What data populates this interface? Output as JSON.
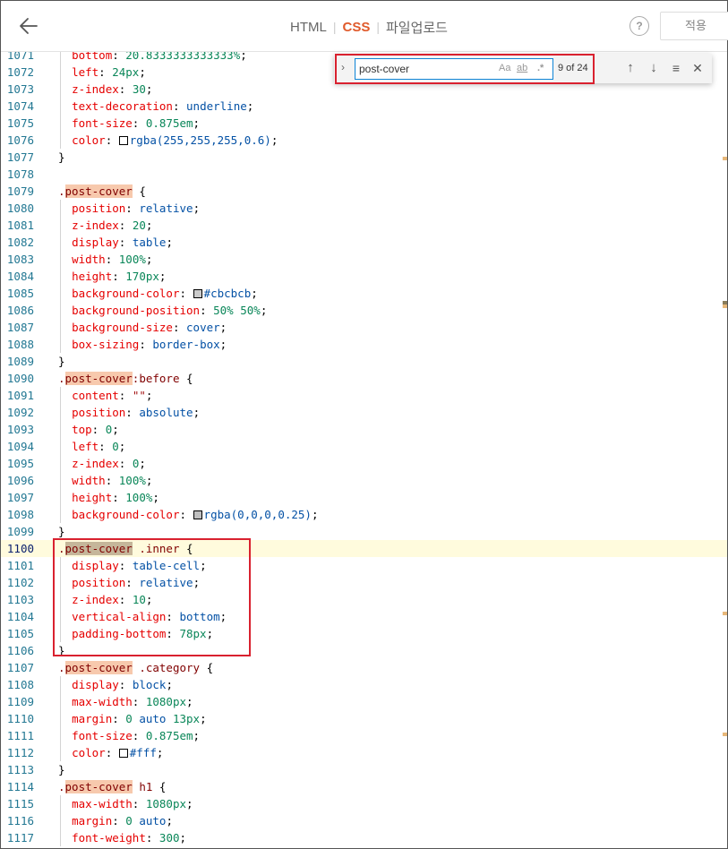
{
  "header": {
    "tabs": [
      {
        "label": "HTML",
        "active": false
      },
      {
        "label": "CSS",
        "active": true
      },
      {
        "label": "파일업로드",
        "active": false
      }
    ],
    "help_label": "?",
    "apply_label": "적용"
  },
  "find": {
    "query": "post-cover",
    "match_case": "Aa",
    "whole_word": "ab",
    "regex": ".*",
    "count": "9 of 24"
  },
  "colors": {
    "accent": "#e05a2b",
    "highlight_box": "#d9212f",
    "match_bg": "#f7c9ad",
    "current_line": "#fffbdd"
  },
  "editor": {
    "current_line": 1100,
    "lines": [
      {
        "n": 1071,
        "html": "  <span class='tk-prop'>bottom</span>: <span class='tk-num'>20.8333333333333%</span>;"
      },
      {
        "n": 1072,
        "html": "  <span class='tk-prop'>left</span>: <span class='tk-num'>24px</span>;"
      },
      {
        "n": 1073,
        "html": "  <span class='tk-prop'>z-index</span>: <span class='tk-num'>30</span>;"
      },
      {
        "n": 1074,
        "html": "  <span class='tk-prop'>text-decoration</span>: <span class='tk-val'>underline</span>;"
      },
      {
        "n": 1075,
        "html": "  <span class='tk-prop'>font-size</span>: <span class='tk-num'>0.875em</span>;"
      },
      {
        "n": 1076,
        "html": "  <span class='tk-prop'>color</span>: <span class='swatch' style='background:rgba(255,255,255,0.6)'></span><span class='tk-val'>rgba(255,255,255,0.6)</span>;"
      },
      {
        "n": 1077,
        "html": "}"
      },
      {
        "n": 1078,
        "html": ""
      },
      {
        "n": 1079,
        "html": "<span class='tk-sel'>.<span class='match'>post-cover</span></span> {"
      },
      {
        "n": 1080,
        "html": "  <span class='tk-prop'>position</span>: <span class='tk-val'>relative</span>;"
      },
      {
        "n": 1081,
        "html": "  <span class='tk-prop'>z-index</span>: <span class='tk-num'>20</span>;"
      },
      {
        "n": 1082,
        "html": "  <span class='tk-prop'>display</span>: <span class='tk-val'>table</span>;"
      },
      {
        "n": 1083,
        "html": "  <span class='tk-prop'>width</span>: <span class='tk-num'>100%</span>;"
      },
      {
        "n": 1084,
        "html": "  <span class='tk-prop'>height</span>: <span class='tk-num'>170px</span>;"
      },
      {
        "n": 1085,
        "html": "  <span class='tk-prop'>background-color</span>: <span class='swatch' style='background:#cbcbcb'></span><span class='tk-val'>#cbcbcb</span>;"
      },
      {
        "n": 1086,
        "html": "  <span class='tk-prop'>background-position</span>: <span class='tk-num'>50% 50%</span>;"
      },
      {
        "n": 1087,
        "html": "  <span class='tk-prop'>background-size</span>: <span class='tk-val'>cover</span>;"
      },
      {
        "n": 1088,
        "html": "  <span class='tk-prop'>box-sizing</span>: <span class='tk-val'>border-box</span>;"
      },
      {
        "n": 1089,
        "html": "}"
      },
      {
        "n": 1090,
        "html": "<span class='tk-sel'>.<span class='match'>post-cover</span>:before</span> {"
      },
      {
        "n": 1091,
        "html": "  <span class='tk-prop'>content</span>: <span class='tk-str'>\"\"</span>;"
      },
      {
        "n": 1092,
        "html": "  <span class='tk-prop'>position</span>: <span class='tk-val'>absolute</span>;"
      },
      {
        "n": 1093,
        "html": "  <span class='tk-prop'>top</span>: <span class='tk-num'>0</span>;"
      },
      {
        "n": 1094,
        "html": "  <span class='tk-prop'>left</span>: <span class='tk-num'>0</span>;"
      },
      {
        "n": 1095,
        "html": "  <span class='tk-prop'>z-index</span>: <span class='tk-num'>0</span>;"
      },
      {
        "n": 1096,
        "html": "  <span class='tk-prop'>width</span>: <span class='tk-num'>100%</span>;"
      },
      {
        "n": 1097,
        "html": "  <span class='tk-prop'>height</span>: <span class='tk-num'>100%</span>;"
      },
      {
        "n": 1098,
        "html": "  <span class='tk-prop'>background-color</span>: <span class='swatch' style='background:rgba(0,0,0,0.25)'></span><span class='tk-val'>rgba(0,0,0,0.25)</span>;"
      },
      {
        "n": 1099,
        "html": "}"
      },
      {
        "n": 1100,
        "html": "<span class='tk-sel'>.<span class='match curmatch'>post-cover</span> .inner</span> {"
      },
      {
        "n": 1101,
        "html": "  <span class='tk-prop'>display</span>: <span class='tk-val'>table-cell</span>;"
      },
      {
        "n": 1102,
        "html": "  <span class='tk-prop'>position</span>: <span class='tk-val'>relative</span>;"
      },
      {
        "n": 1103,
        "html": "  <span class='tk-prop'>z-index</span>: <span class='tk-num'>10</span>;"
      },
      {
        "n": 1104,
        "html": "  <span class='tk-prop'>vertical-align</span>: <span class='tk-val'>bottom</span>;"
      },
      {
        "n": 1105,
        "html": "  <span class='tk-prop'>padding-bottom</span>: <span class='tk-num'>78px</span>;"
      },
      {
        "n": 1106,
        "html": "}"
      },
      {
        "n": 1107,
        "html": "<span class='tk-sel'>.<span class='match'>post-cover</span> .category</span> {"
      },
      {
        "n": 1108,
        "html": "  <span class='tk-prop'>display</span>: <span class='tk-val'>block</span>;"
      },
      {
        "n": 1109,
        "html": "  <span class='tk-prop'>max-width</span>: <span class='tk-num'>1080px</span>;"
      },
      {
        "n": 1110,
        "html": "  <span class='tk-prop'>margin</span>: <span class='tk-num'>0</span> <span class='tk-val'>auto</span> <span class='tk-num'>13px</span>;"
      },
      {
        "n": 1111,
        "html": "  <span class='tk-prop'>font-size</span>: <span class='tk-num'>0.875em</span>;"
      },
      {
        "n": 1112,
        "html": "  <span class='tk-prop'>color</span>: <span class='swatch' style='background:#fff'></span><span class='tk-val'>#fff</span>;"
      },
      {
        "n": 1113,
        "html": "}"
      },
      {
        "n": 1114,
        "html": "<span class='tk-sel'>.<span class='match'>post-cover</span> h1</span> {"
      },
      {
        "n": 1115,
        "html": "  <span class='tk-prop'>max-width</span>: <span class='tk-num'>1080px</span>;"
      },
      {
        "n": 1116,
        "html": "  <span class='tk-prop'>margin</span>: <span class='tk-num'>0</span> <span class='tk-val'>auto</span>;"
      },
      {
        "n": 1117,
        "html": "  <span class='tk-prop'>font-weight</span>: <span class='tk-num'>300</span>;"
      }
    ]
  }
}
